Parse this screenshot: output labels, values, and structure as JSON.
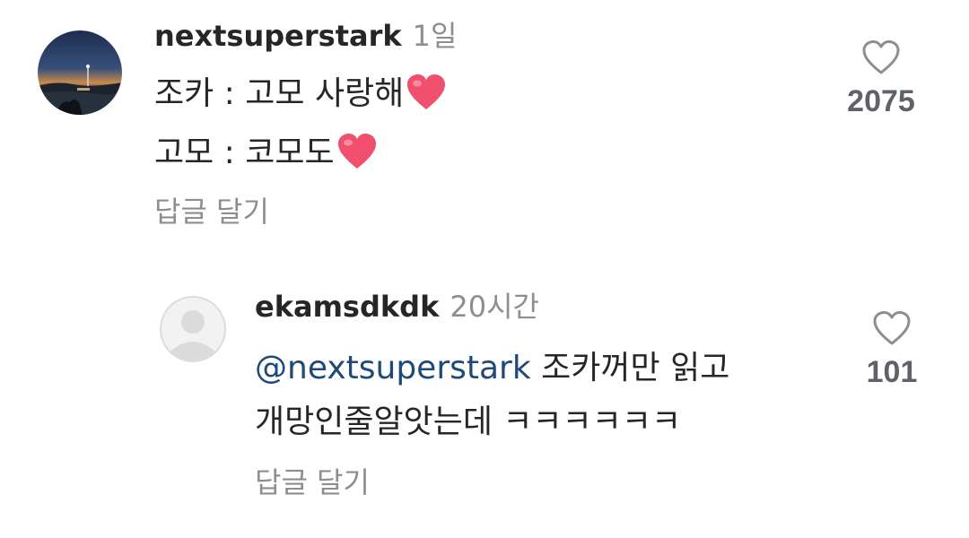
{
  "comments": [
    {
      "username": "nextsuperstark",
      "time": "1일",
      "lines": [
        "조카 : 고모 사랑해",
        "고모 : 코모도"
      ],
      "reply_label": "답글 달기",
      "likes": "2075",
      "avatar_icon": "landscape-sunset-avatar"
    }
  ],
  "replies": [
    {
      "username": "ekamsdkdk",
      "time": "20시간",
      "mention": "@nextsuperstark",
      "line1_rest": " 조카꺼만 읽고",
      "line2": "개망인줄알앗는데 ㅋㅋㅋㅋㅋㅋ",
      "reply_label": "답글 달기",
      "likes": "101",
      "avatar_icon": "default-user-avatar"
    }
  ],
  "colors": {
    "username": "#262626",
    "muted": "#8e8e8e",
    "mention": "#1e4a78",
    "like_count": "#5f6368",
    "heart_emoji": "#f0506e"
  },
  "icons": {
    "like": "heart-outline-icon",
    "emoji": "red-heart-emoji"
  }
}
